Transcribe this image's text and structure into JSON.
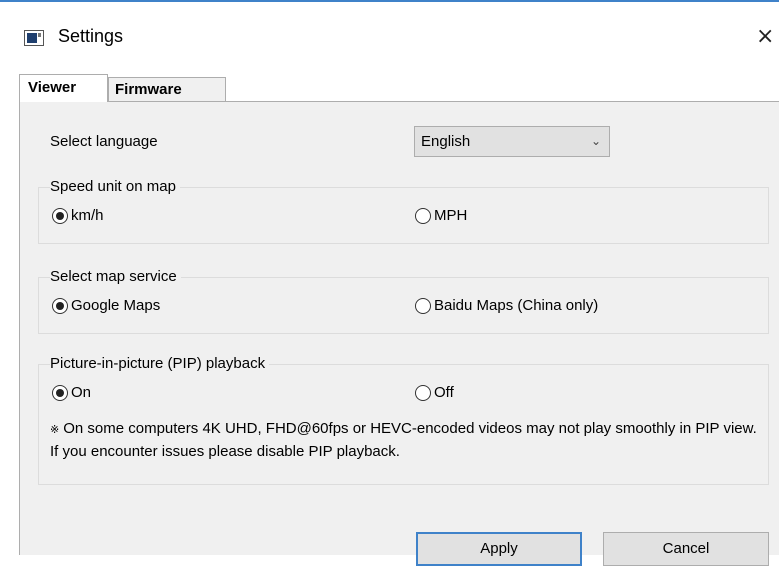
{
  "window": {
    "title": "Settings",
    "close_glyph": "×"
  },
  "tabs": [
    {
      "label": "Viewer",
      "active": true
    },
    {
      "label": "Firmware",
      "active": false
    }
  ],
  "language": {
    "label": "Select language",
    "selected": "English"
  },
  "speed_unit": {
    "title": "Speed unit on map",
    "options": [
      {
        "label": "km/h",
        "checked": true
      },
      {
        "label": "MPH",
        "checked": false
      }
    ]
  },
  "map_service": {
    "title": "Select map service",
    "options": [
      {
        "label": "Google Maps",
        "checked": true
      },
      {
        "label": "Baidu Maps (China only)",
        "checked": false
      }
    ]
  },
  "pip": {
    "title": "Picture-in-picture (PIP) playback",
    "options": [
      {
        "label": "On",
        "checked": true
      },
      {
        "label": "Off",
        "checked": false
      }
    ],
    "note_mark": "※",
    "note": "On some computers 4K UHD, FHD@60fps or HEVC-encoded videos may not play smoothly in PIP view. If you encounter issues please disable PIP playback."
  },
  "buttons": {
    "apply": "Apply",
    "cancel": "Cancel"
  },
  "colors": {
    "accent": "#3f82c9",
    "panel_bg": "#f0f0f0",
    "button_bg": "#e1e1e1",
    "border": "#adadad"
  }
}
